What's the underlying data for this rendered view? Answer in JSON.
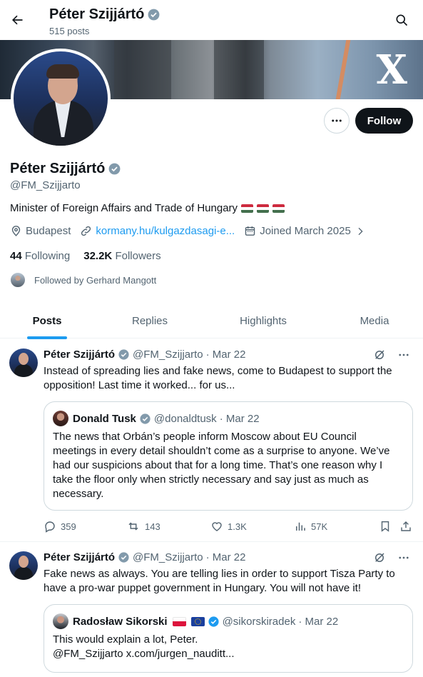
{
  "header": {
    "title": "Péter Szijjártó",
    "posts_count": "515 posts"
  },
  "banner": {
    "logo_text": "X"
  },
  "profile": {
    "name": "Péter Szijjártó",
    "handle": "@FM_Szijjarto",
    "follow_label": "Follow",
    "bio": "Minister of Foreign Affairs and Trade of Hungary",
    "location": "Budapest",
    "website": "kormany.hu/kulgazdasagi-e...",
    "joined": "Joined March 2025",
    "following_count": "44",
    "following_label": "Following",
    "followers_count": "32.2K",
    "followers_label": "Followers",
    "followed_by": "Followed by Gerhard Mangott",
    "flag_colors": [
      "#cd2a3e",
      "#ffffff",
      "#436f4d"
    ]
  },
  "tabs": [
    {
      "label": "Posts",
      "active": true
    },
    {
      "label": "Replies",
      "active": false
    },
    {
      "label": "Highlights",
      "active": false
    },
    {
      "label": "Media",
      "active": false
    }
  ],
  "posts": [
    {
      "name": "Péter Szijjártó",
      "handle": "@FM_Szijjarto",
      "date": "· Mar 22",
      "text": "Instead of spreading lies and fake news, come to Budapest to support the opposition! Last time it worked... for us...",
      "quote": {
        "name": "Donald Tusk",
        "handle": "@donaldtusk",
        "date": "· Mar 22",
        "text": "The news that Orbán’s people inform Moscow about EU Council meetings in every detail shouldn’t come as a surprise to anyone. We’ve had our suspicions about that for a long time. That’s one reason why I take the floor only when strictly necessary and say just as much as necessary."
      },
      "replies": "359",
      "reposts": "143",
      "likes": "1.3K",
      "views": "57K"
    },
    {
      "name": "Péter Szijjártó",
      "handle": "@FM_Szijjarto",
      "date": "· Mar 22",
      "text": "Fake news as always. You are telling lies in order to support Tisza Party to have a pro-war puppet government in Hungary. You will not have it!",
      "quote": {
        "name": "Radosław Sikorski",
        "handle": "@sikorskiradek",
        "date": "· Mar 22",
        "text_line1": "This would explain a lot, Peter.",
        "text_line2": "@FM_Szijjarto x.com/jurgen_nauditt..."
      }
    }
  ],
  "colors": {
    "accent": "#1d9bf0",
    "text": "#0f1419",
    "muted": "#536471",
    "border": "#cfd9de"
  }
}
